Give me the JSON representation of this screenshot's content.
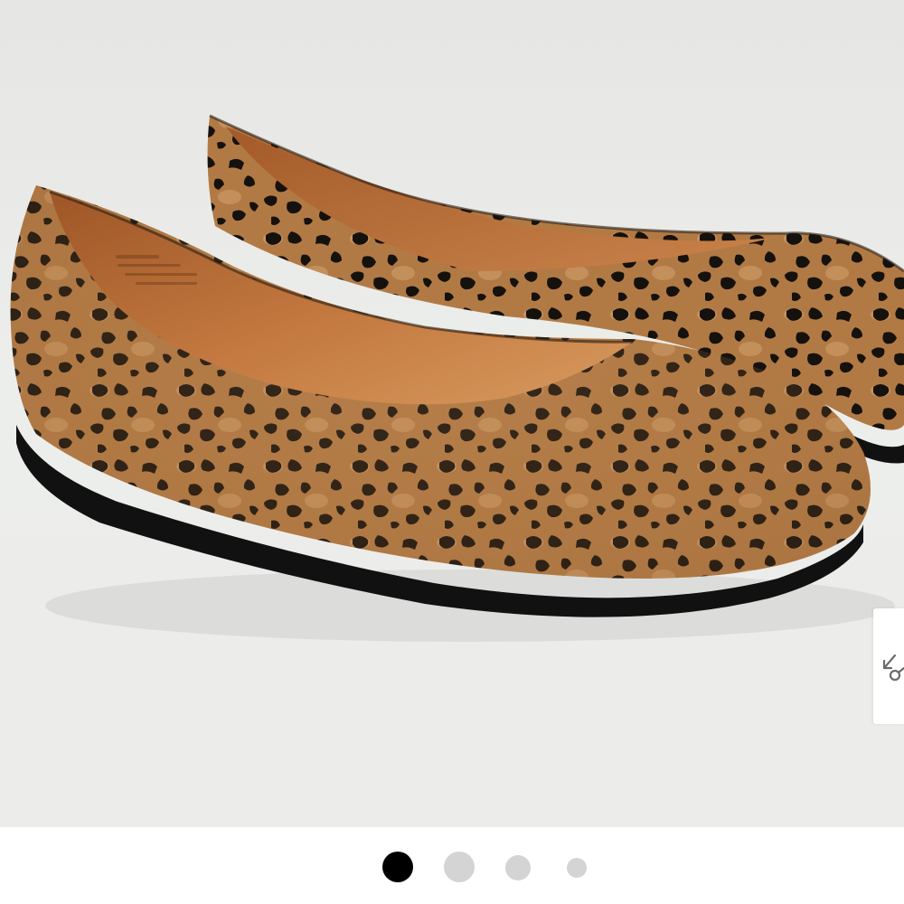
{
  "gallery": {
    "image_alt": "",
    "current_slide": 1,
    "slide_count": 4,
    "colors": {
      "background": "#e9e9e7",
      "dot_active": "#000000",
      "dot_inactive": "#d4d4d4",
      "leopard_base": "#b07a46",
      "leopard_spot": "#15110d",
      "lining": "#b86d36",
      "sole": "#111111"
    },
    "zoom_icon": "expand-arrows-icon",
    "dots": [
      {
        "label": "slide-1",
        "active": true
      },
      {
        "label": "slide-2",
        "active": false
      },
      {
        "label": "slide-3",
        "active": false
      },
      {
        "label": "slide-4",
        "active": false
      }
    ]
  }
}
